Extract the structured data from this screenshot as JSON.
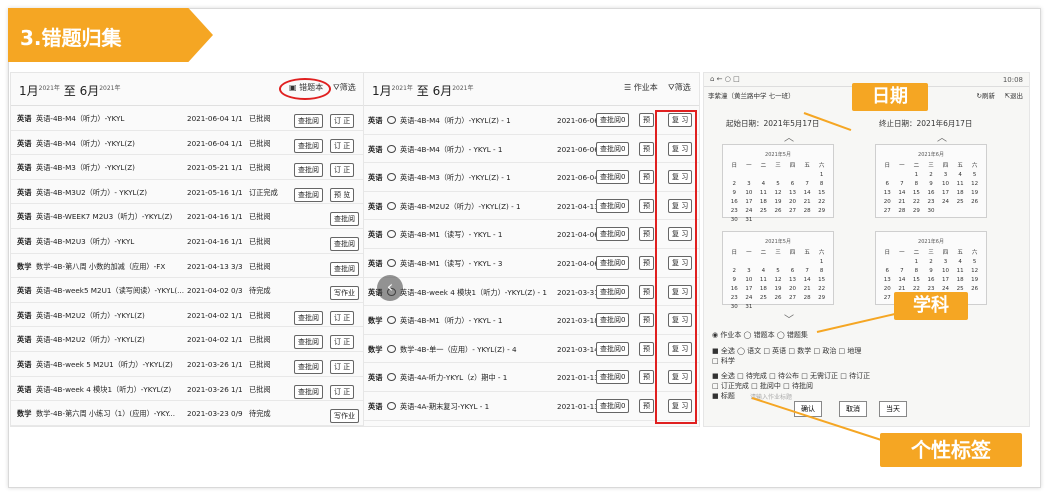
{
  "slide": {
    "title": "3.错题归集"
  },
  "panel1": {
    "date_start_month": "1月",
    "date_start_sup": "2021年",
    "to": "至",
    "date_end_month": "6月",
    "date_end_sup": "2021年",
    "btn_wrongbook": "错题本",
    "btn_filter": "筛选",
    "rows": [
      {
        "subject": "英语",
        "title": "英语-4B-M4（听力）-YKYL",
        "date": "2021-06-04",
        "frac": "1/1",
        "status": "已批阅",
        "b1": "查批阅",
        "b2": "订 正"
      },
      {
        "subject": "英语",
        "title": "英语-4B-M4（听力）-YKYL(Z)",
        "date": "2021-06-04",
        "frac": "1/1",
        "status": "已批阅",
        "b1": "查批阅",
        "b2": "订 正"
      },
      {
        "subject": "英语",
        "title": "英语-4B-M3（听力）-YKYL(Z)",
        "date": "2021-05-21",
        "frac": "1/1",
        "status": "已批阅",
        "b1": "查批阅",
        "b2": "订 正"
      },
      {
        "subject": "英语",
        "title": "英语-4B-M3U2（听力）- YKYL(Z)",
        "date": "2021-05-16",
        "frac": "1/1",
        "status": "订正完成",
        "b1": "查批阅",
        "b2": "预 览"
      },
      {
        "subject": "英语",
        "title": "英语-4B-WEEK7 M2U3（听力）-YKYL(Z)",
        "date": "2021-04-16",
        "frac": "1/1",
        "status": "已批阅",
        "b1": "查批阅",
        "b2": ""
      },
      {
        "subject": "英语",
        "title": "英语-4B-M2U3（听力）-YKYL",
        "date": "2021-04-16",
        "frac": "1/1",
        "status": "已批阅",
        "b1": "查批阅",
        "b2": ""
      },
      {
        "subject": "数学",
        "title": "数学-4B-第八周 小数的加减（应用）-FX",
        "date": "2021-04-13",
        "frac": "3/3",
        "status": "已批阅",
        "b1": "查批阅",
        "b2": ""
      },
      {
        "subject": "英语",
        "title": "英语-4B-week5 M2U1（读写阅读）-YKYL(...",
        "date": "2021-04-02",
        "frac": "0/3",
        "status": "待完成",
        "b1": "写作业",
        "b2": ""
      },
      {
        "subject": "英语",
        "title": "英语-4B-M2U2（听力）-YKYL(Z)",
        "date": "2021-04-02",
        "frac": "1/1",
        "status": "已批阅",
        "b1": "查批阅",
        "b2": "订 正"
      },
      {
        "subject": "英语",
        "title": "英语-4B-M2U2（听力）-YKYL(Z)",
        "date": "2021-04-02",
        "frac": "1/1",
        "status": "已批阅",
        "b1": "查批阅",
        "b2": "订 正"
      },
      {
        "subject": "英语",
        "title": "英语-4B-week 5 M2U1（听力）-YKYL(Z)",
        "date": "2021-03-26",
        "frac": "1/1",
        "status": "已批阅",
        "b1": "查批阅",
        "b2": "订 正"
      },
      {
        "subject": "英语",
        "title": "英语-4B-week 4 模块1（听力）-YKYL(Z)",
        "date": "2021-03-26",
        "frac": "1/1",
        "status": "已批阅",
        "b1": "查批阅",
        "b2": "订 正"
      },
      {
        "subject": "数学",
        "title": "数学-4B-第六周 小练习（1）(应用）-YKY...",
        "date": "2021-03-23",
        "frac": "0/9",
        "status": "待完成",
        "b1": "写作业",
        "b2": ""
      }
    ]
  },
  "panel2": {
    "date_start_month": "1月",
    "date_start_sup": "2021年",
    "to": "至",
    "date_end_month": "6月",
    "date_end_sup": "2021年",
    "btn_homework": "作业本",
    "btn_filter": "筛选",
    "rows": [
      {
        "subject": "英语",
        "title": "英语-4B-M4（听力）-YKYL(Z) - 1",
        "date": "2021-06-06",
        "b1": "查批阅0",
        "b2": "预",
        "b3": "复 习"
      },
      {
        "subject": "英语",
        "title": "英语-4B-M4（听力）- YKYL - 1",
        "date": "2021-06-06",
        "b1": "查批阅0",
        "b2": "预",
        "b3": "复 习"
      },
      {
        "subject": "英语",
        "title": "英语-4B-M3（听力）-YKYL(Z) - 1",
        "date": "2021-06-04",
        "b1": "查批阅0",
        "b2": "预",
        "b3": "复 习"
      },
      {
        "subject": "英语",
        "title": "英语-4B-M2U2（听力）-YKYL(Z) - 1",
        "date": "2021-04-13",
        "b1": "查批阅0",
        "b2": "预",
        "b3": "复 习"
      },
      {
        "subject": "英语",
        "title": "英语-4B-M1（读写）- YKYL - 1",
        "date": "2021-04-06",
        "b1": "查批阅0",
        "b2": "预",
        "b3": "复 习"
      },
      {
        "subject": "英语",
        "title": "英语-4B-M1（读写）- YKYL - 3",
        "date": "2021-04-06",
        "b1": "查批阅0",
        "b2": "预",
        "b3": "复 习"
      },
      {
        "subject": "英语",
        "title": "英语-4B-week 4 模块1（听力）-YKYL(Z) - 1",
        "date": "2021-03-31",
        "b1": "查批阅0",
        "b2": "预",
        "b3": "复 习"
      },
      {
        "subject": "数学",
        "title": "英语-4B-M1（听力）- YKYL - 1",
        "date": "2021-03-18",
        "b1": "查批阅0",
        "b2": "预",
        "b3": "复 习"
      },
      {
        "subject": "数学",
        "title": "数学-4B-单一（应用）- YKYL(Z) - 4",
        "date": "2021-03-14",
        "b1": "查批阅0",
        "b2": "预",
        "b3": "复 习"
      },
      {
        "subject": "英语",
        "title": "英语-4A-听力-YKYL（z）期中 - 1",
        "date": "2021-01-13",
        "b1": "查批阅0",
        "b2": "预",
        "b3": "复 习"
      },
      {
        "subject": "英语",
        "title": "英语-4A-期末复习-YKYL - 1",
        "date": "2021-01-13",
        "b1": "查批阅0",
        "b2": "预",
        "b3": "复 习"
      }
    ]
  },
  "panel3": {
    "time": "10:08",
    "user": "李紫潼（黄兰路中学 七一班）",
    "refresh": "刷新",
    "logout": "退出",
    "start_date_label": "起始日期：2021年5月17日",
    "end_date_label": "终止日期：2021年6月17日",
    "cal_months": [
      "2021年5月",
      "2021年6月",
      "2021年5月",
      "2021年6月"
    ],
    "weekdays": [
      "日",
      "一",
      "二",
      "三",
      "四",
      "五",
      "六"
    ],
    "type_row": "◉ 作业本 ◯ 错题本 ◯ 错题集",
    "subject_row": "■ 全选 ◯ 语文 □ 英语 □ 数学 □ 政治 □ 地理",
    "subject_row2": "□ 科学",
    "status_row": "■ 全选   □ 待完成   □ 待公布   □ 无需订正 □ 待订正",
    "status_row2": "□ 订正完成 □ 批阅中   □ 待批阅",
    "tag_label": "■ 标题",
    "tag_placeholder": "请输入作业标题",
    "btn_confirm": "确认",
    "btn_cancel": "取消",
    "btn_today": "当天"
  },
  "callouts": {
    "date": "日期",
    "subject": "学科",
    "tag": "个性标签"
  },
  "colors": {
    "accent_orange": "#f5a623",
    "highlight_red": "#e02020"
  }
}
